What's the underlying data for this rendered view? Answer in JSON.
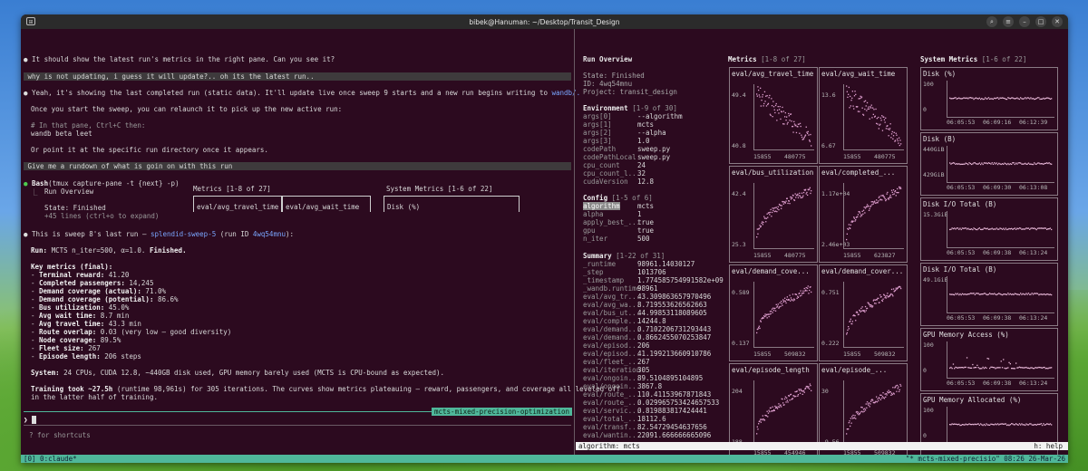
{
  "window": {
    "title": "bibek@Hanuman: ~/Desktop/Transit_Design"
  },
  "left": {
    "l1": "It should show the latest run's metrics in the right pane. Can you see it?",
    "l2": "why is not updating, i guess it will update?.. oh its the latest run..",
    "l3a": "Yeah, it's showing the last completed run (static data). It'll update live once sweep 9 starts and a new run begins writing to ",
    "l3b": "wandb/.",
    "l4": "Once you start the sweep, you can relaunch it to pick up the new active run:",
    "l5": "# In that pane, Ctrl+C then:",
    "l6": "wandb beta leet",
    "l7": "Or point it at the specific run directory once it appears.",
    "l8": "Give me a rundown of what is goin on with this run",
    "bash": "Bash",
    "bashcmd": "(tmux capture-pane -t {next} -p)",
    "run_overview": "Run Overview",
    "metrics_hdr": "Metrics [1-8 of 27]",
    "sysm_hdr": "System Metrics [1-6 of 22]",
    "state": "State: Finished",
    "more": "+45 lines (ctrl+o to expand)",
    "box1": "eval/avg_travel_time",
    "box2": "eval/avg_wait_time",
    "box3": "Disk (%)",
    "s1a": "This is sweep 8's last run — ",
    "s1b": "splendid-sweep-5",
    "s1c": " (run ID ",
    "s1d": "4wq54mnu",
    "s1e": "):",
    "run_lbl": "Run:",
    "run_val": " MCTS n_iter=500, α=1.0. ",
    "run_fin": "Finished.",
    "km": "Key metrics (final):",
    "metrics": [
      [
        "Terminal reward:",
        " 41.20"
      ],
      [
        "Completed passengers:",
        " 14,245"
      ],
      [
        "Demand coverage (actual):",
        " 71.0%"
      ],
      [
        "Demand coverage (potential):",
        " 86.6%"
      ],
      [
        "Bus utilization:",
        " 45.0%"
      ],
      [
        "Avg wait time:",
        " 8.7 min"
      ],
      [
        "Avg travel time:",
        " 43.3 min"
      ],
      [
        "Route overlap:",
        " 0.03 (very low — good diversity)"
      ],
      [
        "Node coverage:",
        " 89.5%"
      ],
      [
        "Fleet size:",
        " 267"
      ],
      [
        "Episode length:",
        " 206 steps"
      ]
    ],
    "sys_lbl": "System:",
    "sys_val": " 24 CPUs, CUDA 12.8, ~440GB disk used, GPU memory barely used (MCTS is CPU-bound as expected).",
    "train_lbl": "Training took ~27.5h",
    "train_val": " (runtime 98,961s) for 305 iterations. The curves show metrics plateauing — reward, passengers, and coverage all leveled off",
    "train_val2": "in the latter half of training.",
    "tag": "mcts-mixed-precision-optimization",
    "prompt": "❯",
    "shortcuts": "? for shortcuts",
    "status_left": "[0] 0:claude*",
    "status_right": "\"* mcts-mixed-precisio\" 08:26 26-Mar-26"
  },
  "overview": {
    "title": "Run Overview",
    "state": "State: Finished",
    "id": "ID: 4wq54mnu",
    "project": "Project: transit_design",
    "env_hdr": "Environment",
    "env_count": "[1-9 of 30]",
    "env": [
      [
        "args[0]",
        "--algorithm"
      ],
      [
        "args[1]",
        "mcts"
      ],
      [
        "args[2]",
        "--alpha"
      ],
      [
        "args[3]",
        "1.0"
      ],
      [
        "codePath",
        "sweep.py"
      ],
      [
        "codePathLocal",
        "sweep.py"
      ],
      [
        "cpu_count",
        "24"
      ],
      [
        "cpu_count_l...",
        "32"
      ],
      [
        "cudaVersion",
        "12.8"
      ]
    ],
    "cfg_hdr": "Config",
    "cfg_count": "[1-5 of 6]",
    "cfg": [
      [
        "algorithm",
        "mcts"
      ],
      [
        "alpha",
        "1"
      ],
      [
        "apply_best_...",
        "true"
      ],
      [
        "gpu",
        "true"
      ],
      [
        "n_iter",
        "500"
      ]
    ],
    "sum_hdr": "Summary",
    "sum_count": "[1-22 of 31]",
    "sum": [
      [
        "_runtime",
        "98961.14030127"
      ],
      [
        "_step",
        "1013706"
      ],
      [
        "_timestamp",
        "1.774585754991582e+09"
      ],
      [
        "_wandb.runtime",
        "98961"
      ],
      [
        "eval/avg_tr...",
        "43.309863657970496"
      ],
      [
        "eval/avg_wa...",
        "8.719553626562663"
      ],
      [
        "eval/bus_ut...",
        "44.99853118089605"
      ],
      [
        "eval/comple...",
        "14244.8"
      ],
      [
        "eval/demand...",
        "0.7102206731293443"
      ],
      [
        "eval/demand...",
        "0.8662455070253847"
      ],
      [
        "eval/episod...",
        "206"
      ],
      [
        "eval/episod...",
        "41.199213660910786"
      ],
      [
        "eval/fleet_...",
        "267"
      ],
      [
        "eval/iteration",
        "305"
      ],
      [
        "eval/ongoin...",
        "89.5104895104895"
      ],
      [
        "eval/ongoin...",
        "3867.8"
      ],
      [
        "eval/route_...",
        "110.41153967871843"
      ],
      [
        "eval/route_...",
        "0.029965753424657533"
      ],
      [
        "eval/servic...",
        "0.819883817424441"
      ],
      [
        "eval/total_...",
        "18112.6"
      ],
      [
        "eval/transf...",
        "82.54729454637656"
      ],
      [
        "eval/wantin...",
        "22091.666666665096"
      ]
    ]
  },
  "metrics_pane": {
    "title": "Metrics",
    "count": "[1-8 of 27]",
    "panels": [
      {
        "title": "eval/avg_travel_time",
        "ytop": "49.4",
        "ybot": "40.8",
        "x1": "15855",
        "x2": "480775"
      },
      {
        "title": "eval/avg_wait_time",
        "ytop": "13.6",
        "ybot": "6.67",
        "x1": "15855",
        "x2": "480775"
      },
      {
        "title": "eval/bus_utilization",
        "ytop": "42.4",
        "ybot": "25.3",
        "x1": "15855",
        "x2": "480775"
      },
      {
        "title": "eval/completed_...",
        "ytop": "1.17e+04",
        "ybot": "2.46e+03",
        "x1": "15855",
        "x2": "623827"
      },
      {
        "title": "eval/demand_cove...",
        "ytop": "0.589",
        "ybot": "0.137",
        "x1": "15855",
        "x2": "509832"
      },
      {
        "title": "eval/demand_cover...",
        "ytop": "0.751",
        "ybot": "0.222",
        "x1": "15855",
        "x2": "509832"
      },
      {
        "title": "eval/episode_length",
        "ytop": "204",
        "ybot": "188",
        "x1": "15855",
        "x2": "454946"
      },
      {
        "title": "eval/episode_...",
        "ytop": "30",
        "ybot": "-9.56",
        "x1": "15855",
        "x2": "509832"
      }
    ]
  },
  "system_pane": {
    "title": "System Metrics",
    "count": "[1-6 of 22]",
    "panels": [
      {
        "title": "Disk (%)",
        "y": "100",
        "y2": "0",
        "t1": "06:05:53",
        "t2": "06:09:16",
        "t3": "06:12:39"
      },
      {
        "title": "Disk (B)",
        "y": "440GiB",
        "y2": "429GiB",
        "t1": "06:05:53",
        "t2": "06:09:30",
        "t3": "06:13:08"
      },
      {
        "title": "Disk I/O Total (B)",
        "y": "15.3GiB",
        "y2": "",
        "t1": "06:05:53",
        "t2": "06:09:38",
        "t3": "06:13:24"
      },
      {
        "title": "Disk I/O Total (B)",
        "y": "49.1GiB",
        "y2": "",
        "t1": "06:05:53",
        "t2": "06:09:38",
        "t3": "06:13:24"
      },
      {
        "title": "GPU Memory Access (%)",
        "y": "100",
        "y2": "0",
        "t1": "06:05:53",
        "t2": "06:09:38",
        "t3": "06:13:24"
      },
      {
        "title": "GPU Memory Allocated (%)",
        "y": "100",
        "y2": "0",
        "t1": "06:05:53",
        "t2": "06:09:38",
        "t3": "06:13:24"
      }
    ]
  },
  "footer": {
    "alg": "algorithm: mcts",
    "help": "h: help"
  },
  "colors": {
    "accent": "#4fb79a",
    "dots": "#e0a0d0",
    "bg": "#2c0a1f"
  }
}
